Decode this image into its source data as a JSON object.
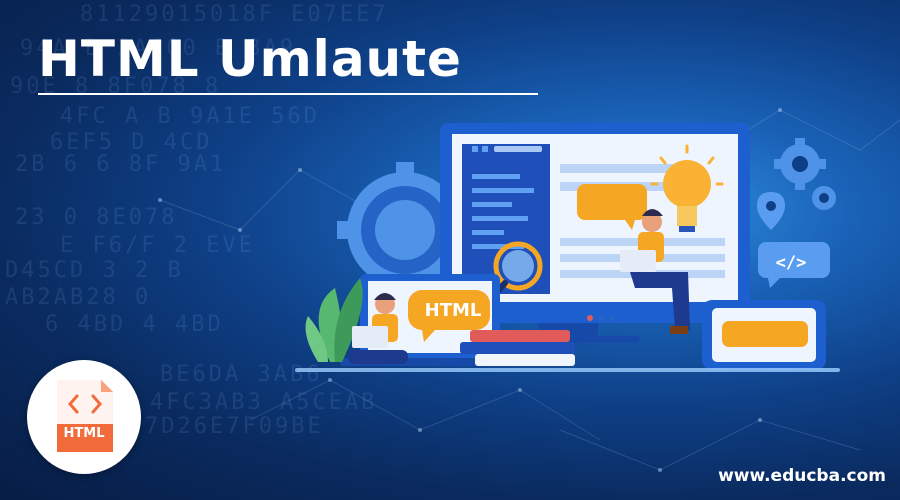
{
  "header": {
    "title": "HTML Umlaute"
  },
  "badge": {
    "label": "HTML",
    "icon": "code-brackets-icon"
  },
  "illustration": {
    "bubble_label": "HTML",
    "code_tag": "</>"
  },
  "footer": {
    "website": "www.educba.com"
  },
  "background_code": [
    "81129015018F   E07EE7",
    "94A   B   3AC00   B   3A9",
    "90E   8   8F078   8",
    "4FC A   B   9A1E   56D",
    "6EF5   D   4CD",
    "2B 6   6   8F 9A1",
    "23   0   8E078",
    "E F6/F   2 EVE",
    "D45CD   3   2 B",
    "AB2AB28   0",
    "6 4BD   4 4BD",
    "BE6DA   3AB6",
    "4FC3AB3   A5CEAB",
    "7D26E7F09BE"
  ],
  "colors": {
    "background": "#0e3f86",
    "accent_orange": "#f5a623",
    "badge_orange": "#f26b3a",
    "text": "#ffffff"
  }
}
